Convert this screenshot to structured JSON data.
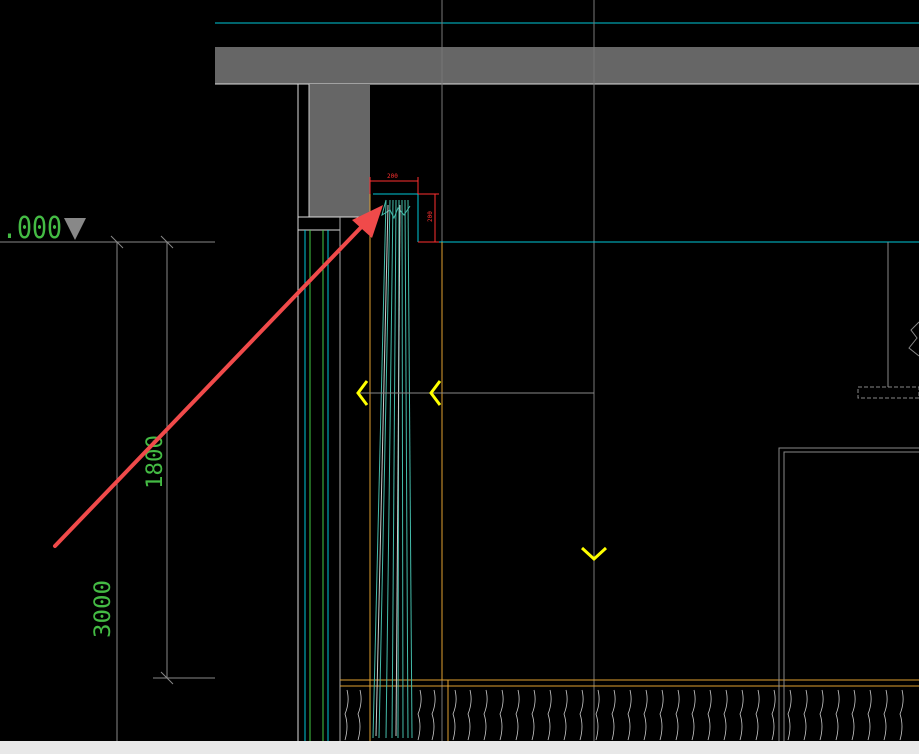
{
  "drawing": {
    "elevation_label": ".000",
    "dim_200_horizontal": "200",
    "dim_200_vertical": "200",
    "dim_1800": "1800",
    "dim_3000": "3000"
  },
  "colors": {
    "background": "#000000",
    "cyan": "#00c8d8",
    "slab_gray": "#666666",
    "annotation_red": "#ff3030",
    "dim_green": "#44bb44",
    "yellow_marker": "#ffff00",
    "orange_line": "#e0a030",
    "arrow_red": "#f04a4a",
    "status_bar": "#e8e8e8"
  },
  "icons": {
    "elevation_marker": "triangle-down-icon",
    "section_markers": "chevron-icon",
    "pointer": "arrow-icon"
  }
}
